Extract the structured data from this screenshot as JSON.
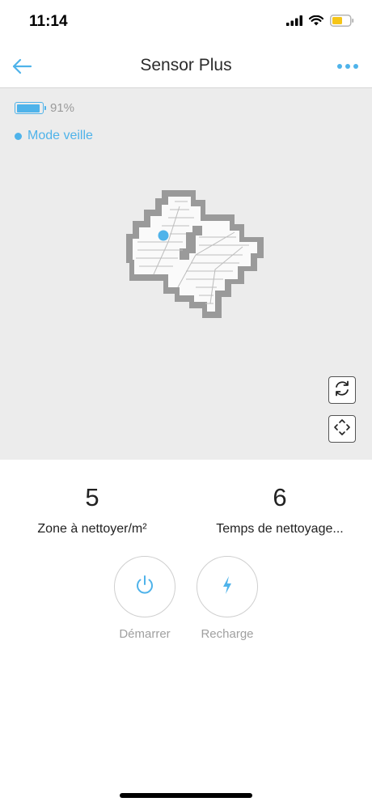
{
  "status_bar": {
    "time": "11:14",
    "icons": [
      "signal-icon",
      "wifi-icon",
      "battery-icon"
    ],
    "battery_color": "#f5c518"
  },
  "nav": {
    "title": "Sensor Plus",
    "back_icon": "arrow-left-icon",
    "more_icon": "more-dots-icon"
  },
  "device": {
    "battery_percent_label": "91%",
    "battery_level": 0.91,
    "mode_label": "Mode veille"
  },
  "map": {
    "controls": [
      "rotate-icon",
      "expand-icon"
    ]
  },
  "stats": {
    "area": {
      "value": "5",
      "label": "Zone à nettoyer/m²"
    },
    "time": {
      "value": "6",
      "label": "Temps de nettoyage..."
    }
  },
  "actions": {
    "start_label": "Démarrer",
    "start_icon": "power-icon",
    "recharge_label": "Recharge",
    "recharge_icon": "lightning-icon"
  },
  "colors": {
    "accent": "#4fb3ea",
    "map_background": "#ececec",
    "map_wall": "#9a9a9a",
    "text_muted": "#a0a0a0"
  }
}
